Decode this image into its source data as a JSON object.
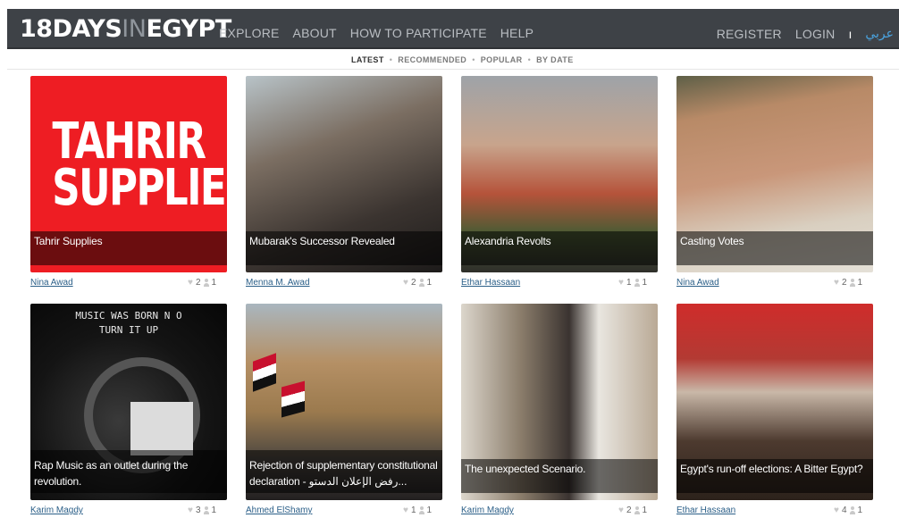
{
  "header": {
    "logo_bold_a": "18DAYS",
    "logo_light": "IN",
    "logo_bold_b": "EGYPT",
    "nav": [
      "EXPLORE",
      "ABOUT",
      "HOW TO PARTICIPATE",
      "HELP"
    ],
    "register": "REGISTER",
    "login": "LOGIN",
    "separator": "ı",
    "arabic": "عربي"
  },
  "filters": {
    "items": [
      "LATEST",
      "RECOMMENDED",
      "POPULAR",
      "BY DATE"
    ],
    "active": "LATEST"
  },
  "cards": [
    {
      "title": "Tahrir Supplies",
      "author": "Nina Awad",
      "likes": "2",
      "contributors": "1",
      "art_text": [
        "TAHRIR",
        "SUPPLIES"
      ]
    },
    {
      "title": "Mubarak's Successor Revealed",
      "author": "Menna M. Awad",
      "likes": "2",
      "contributors": "1"
    },
    {
      "title": "Alexandria Revolts",
      "author": "Ethar Hassaan",
      "likes": "1",
      "contributors": "1"
    },
    {
      "title": "Casting Votes",
      "author": "Nina Awad",
      "likes": "2",
      "contributors": "1"
    },
    {
      "title": "Rap Music as an outlet during the revolution.",
      "author": "Karim Magdy",
      "likes": "3",
      "contributors": "1",
      "art_text": [
        "MUSIC WAS BORN N O",
        "TURN IT UP"
      ]
    },
    {
      "title": "Rejection of supplementary constitutional declaration - رفض الإعلان الدستو...",
      "author": "Ahmed ElShamy",
      "likes": "1",
      "contributors": "1"
    },
    {
      "title": "The unexpected Scenario.",
      "author": "Karim Magdy",
      "likes": "2",
      "contributors": "1"
    },
    {
      "title": "Egypt's run-off elections: A Bitter Egypt?",
      "author": "Ethar Hassaan",
      "likes": "4",
      "contributors": "1"
    }
  ],
  "colors": {
    "header_bg": "#3e4247",
    "link": "#2b5f88",
    "accent_red": "#ee1d23",
    "arabic_link": "#4aa3df"
  }
}
